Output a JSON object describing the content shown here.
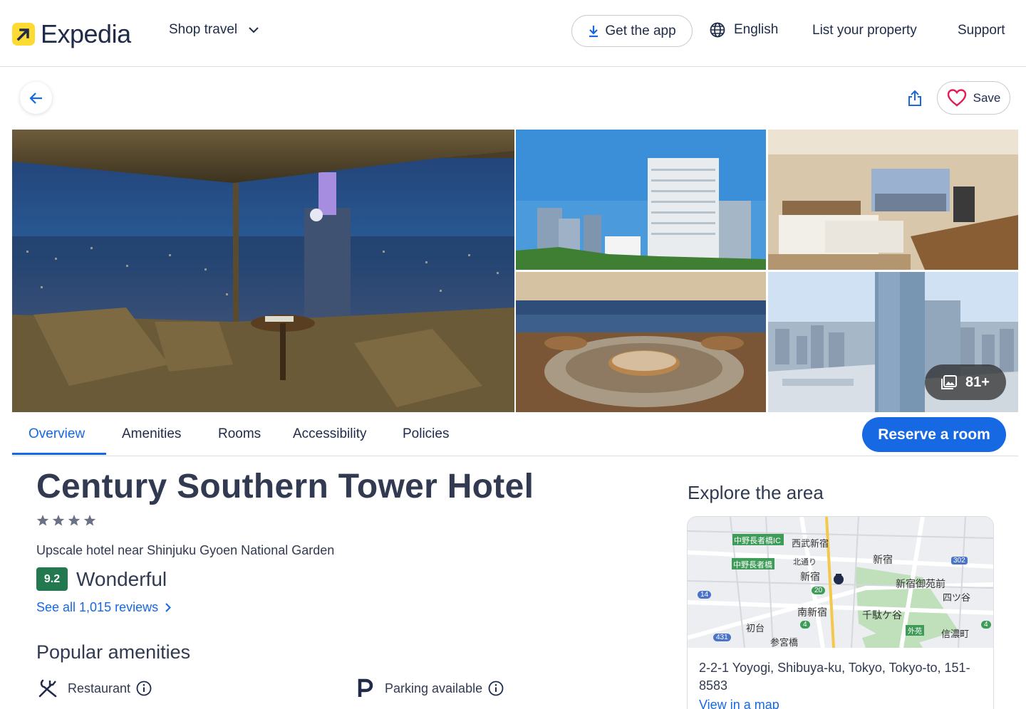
{
  "header": {
    "logo_text": "Expedia",
    "shop_travel": "Shop travel",
    "get_app": "Get the app",
    "language": "English",
    "list_property": "List your property",
    "support": "Support"
  },
  "toolbar": {
    "save_label": "Save"
  },
  "gallery": {
    "photo_count": "81+"
  },
  "tabs": [
    {
      "label": "Overview",
      "active": true
    },
    {
      "label": "Amenities",
      "active": false
    },
    {
      "label": "Rooms",
      "active": false
    },
    {
      "label": "Accessibility",
      "active": false
    },
    {
      "label": "Policies",
      "active": false
    }
  ],
  "reserve_label": "Reserve a room",
  "hotel": {
    "name": "Century Southern Tower Hotel",
    "star_rating": 4,
    "tagline": "Upscale hotel near Shinjuku Gyoen National Garden",
    "rating_score": "9.2",
    "rating_word": "Wonderful",
    "reviews_link": "See all 1,015 reviews"
  },
  "amenities": {
    "title": "Popular amenities",
    "items": [
      {
        "label": "Restaurant",
        "icon": "restaurant-icon"
      },
      {
        "label": "Parking available",
        "icon": "parking-icon"
      }
    ]
  },
  "explore": {
    "title": "Explore the area",
    "address": "2-2-1 Yoyogi, Shibuya-ku, Tokyo, Tokyo-to, 151-8583",
    "map_link": "View in a map",
    "map_labels": [
      "中野長者橋IC",
      "西武新宿",
      "中野長者橋",
      "北通り",
      "新宿",
      "新宿",
      "302",
      "新宿御苑前",
      "四ツ谷",
      "14",
      "20",
      "南新宿",
      "千駄ケ谷",
      "初台",
      "4",
      "外苑",
      "信濃町",
      "431",
      "参宮橋",
      "4"
    ]
  },
  "colors": {
    "brand_blue": "#1668e3",
    "brand_yellow": "#fddb32",
    "rating_green": "#227950",
    "text_dark": "#1f2b49"
  }
}
